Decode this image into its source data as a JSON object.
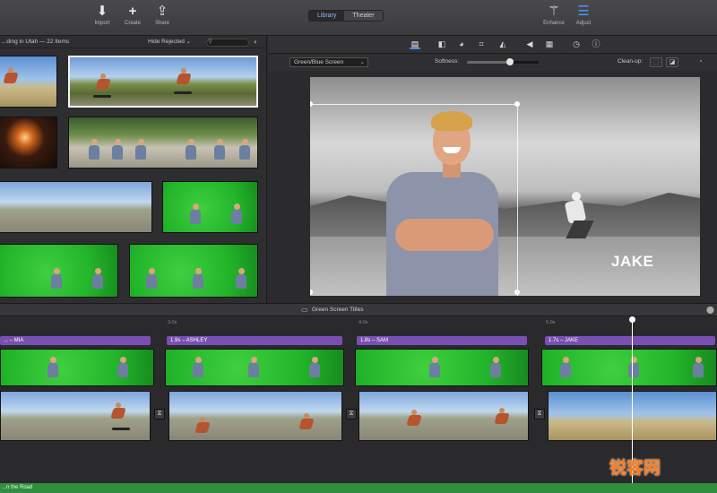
{
  "toolbar": {
    "import_label": "Import",
    "create_label": "Create",
    "share_label": "Share",
    "library_tab": "Library",
    "theater_tab": "Theater",
    "enhance_label": "Enhance",
    "adjust_label": "Adjust"
  },
  "browser": {
    "title": "...ding in Utah  —  22 Items",
    "filter": "Hide Rejected",
    "filter_chevron": "⌄",
    "search_placeholder": ""
  },
  "viewer": {
    "overlay_mode": "Green/Blue Screen",
    "softness_label": "Softness:",
    "softness_value": 0.6,
    "clean_up_label": "Clean-up:",
    "lower_third": "JAKE"
  },
  "timeline": {
    "title": "Green Screen Titles",
    "ruler": [
      "3.0s",
      "4.0s",
      "5.0s"
    ],
    "title_clips": [
      "... – MIA",
      "1.9s – ASHLEY",
      "1.8s – SAM",
      "1.7s – JAKE"
    ],
    "audio_track_label": "...n the Road"
  },
  "watermark": "锐客网",
  "colors": {
    "accent": "#3d8bff",
    "title_clip": "#7a4fb3",
    "audio_track": "#2e8f3e",
    "watermark": "#ff7a1a"
  }
}
